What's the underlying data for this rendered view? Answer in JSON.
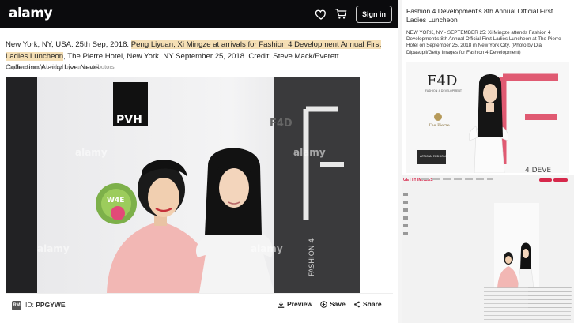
{
  "header": {
    "logo": "alamy",
    "signin_label": "Sign in"
  },
  "caption": {
    "lead": "New York, NY, USA. 25th Sep, 2018. ",
    "highlight": "Peng Liyuan, Xi Mingze at arrivals for Fashion 4 Development Annual First Ladies Luncheon",
    "rest": ", The Pierre Hotel, New York, NY September 25, 2018. Credit: Steve Mack/Everett Collection/Alamy Live News",
    "note": "Captions are provided by our contributors."
  },
  "photo": {
    "watermark": "alamy",
    "backdrop_text": "PVH",
    "logo_text": "F4D",
    "badge_text": "W4E",
    "side_text": "FASHION 4"
  },
  "bottom_bar": {
    "logo": "RM",
    "id_label": "ID:",
    "id_value": "PPGYWE",
    "preview_label": "Preview",
    "save_label": "Save",
    "share_label": "Share"
  },
  "article": {
    "title": "Fashion 4 Development's 8th Annual Official First Ladies Luncheon",
    "description": "NEW YORK, NY - SEPTEMBER 25: Xi Mingze attends Fashion 4 Development's 8th Annual Official First Ladies Luncheon at The Pierre Hotel on September 25, 2018 in New York City. (Photo by Dia Dipasupil/Getty Images for Fashion 4 Development)",
    "photo_logo": "F4D",
    "photo_sub": "FASHION 4 DEVELOPMENT",
    "hotel_sign": "The Pierre",
    "banner": "AFRICAN FASHION",
    "big_text": "4 DEVE",
    "brand": "GETTY IMAGES"
  },
  "colors": {
    "highlight": "#f5dfb5",
    "topbar": "#0b0b0d",
    "brand_pink": "#d6284b"
  }
}
